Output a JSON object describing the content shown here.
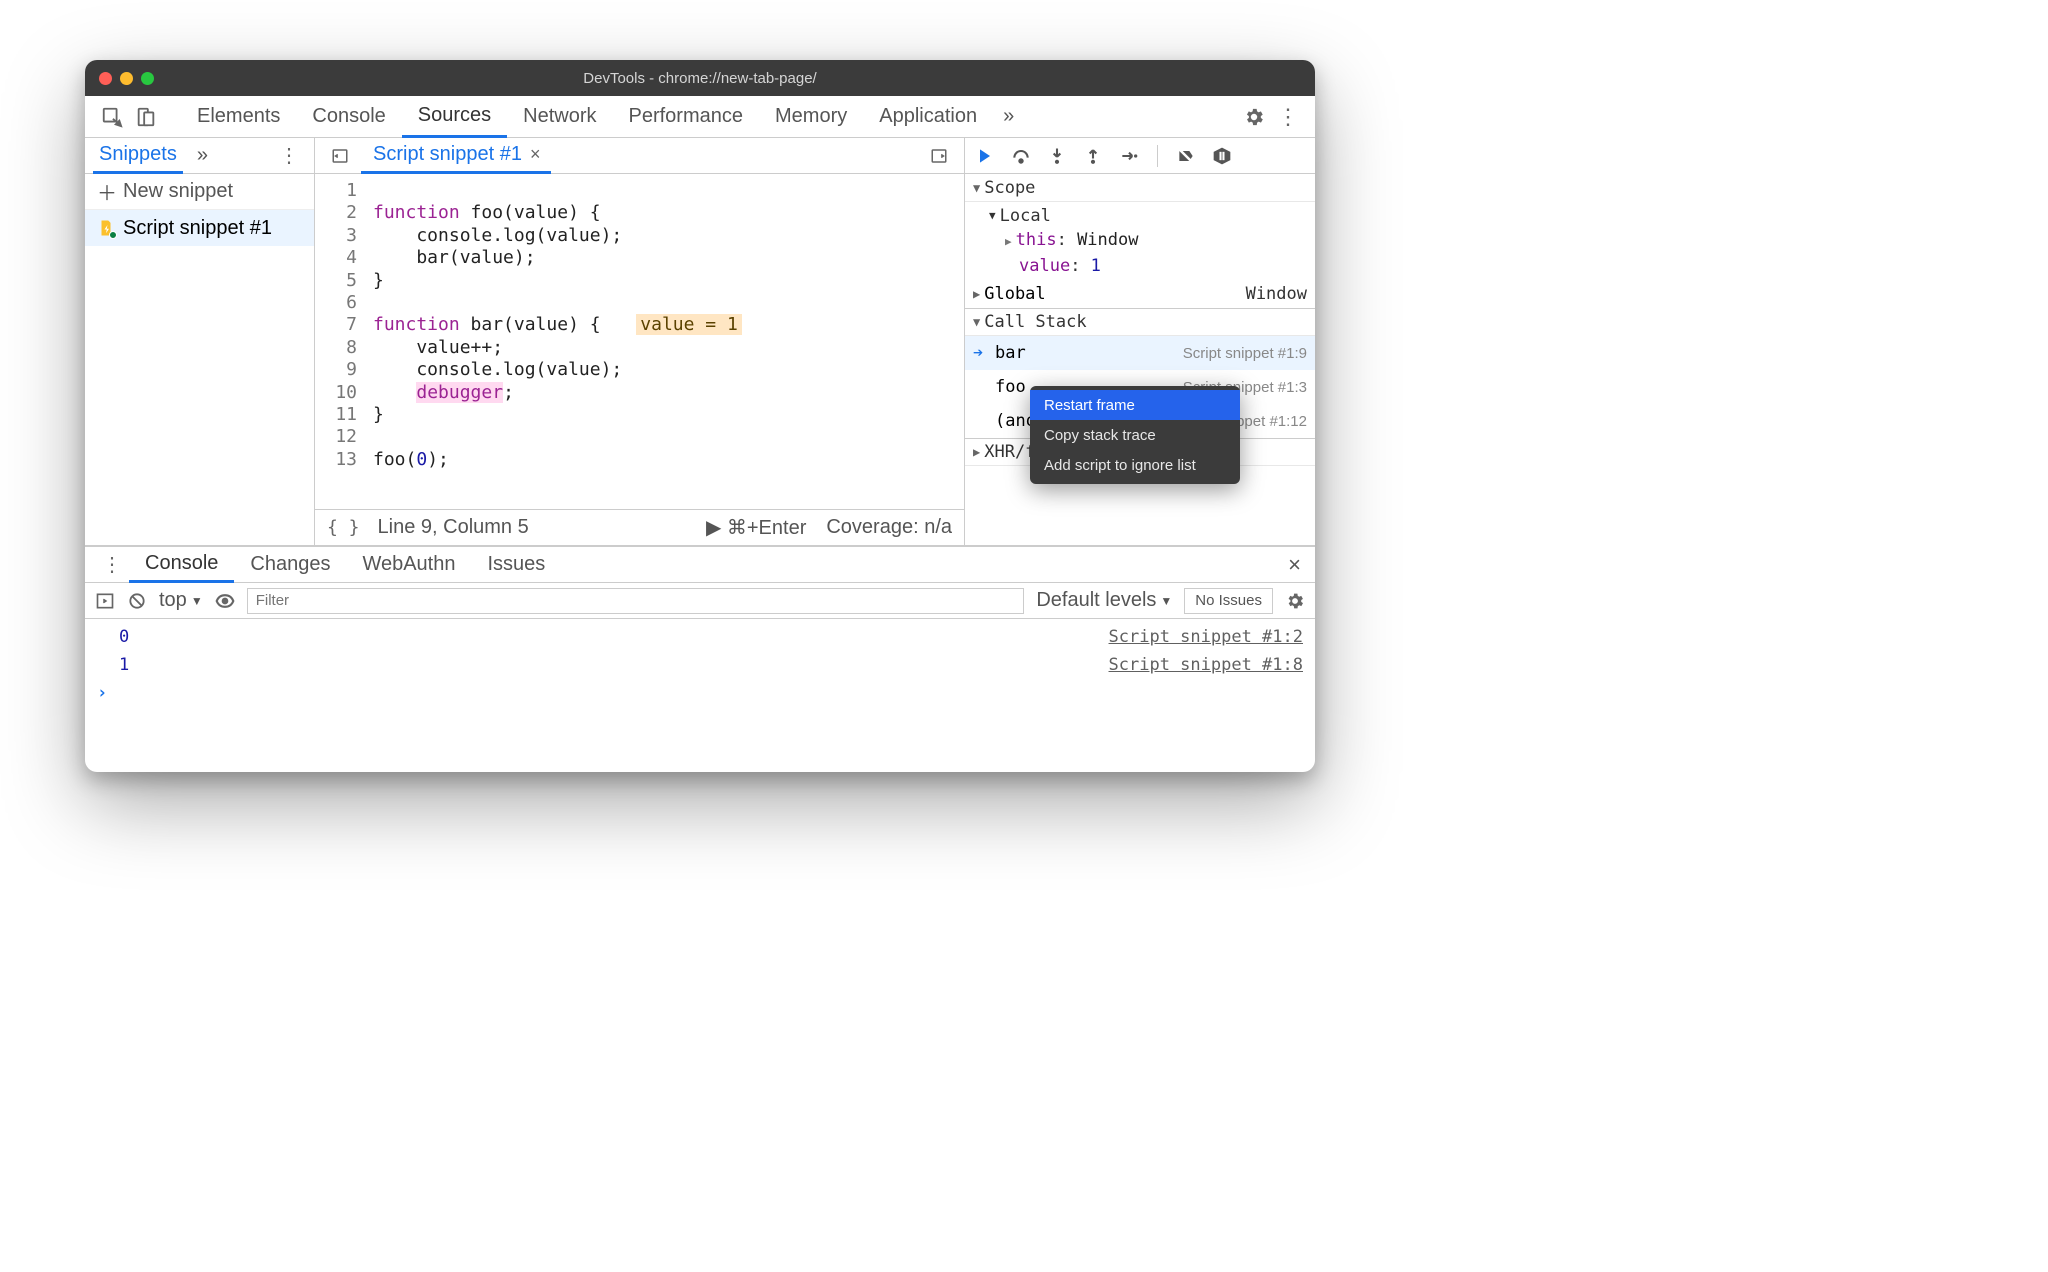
{
  "window": {
    "title": "DevTools - chrome://new-tab-page/"
  },
  "mainTabs": {
    "items": [
      "Elements",
      "Console",
      "Sources",
      "Network",
      "Performance",
      "Memory",
      "Application"
    ],
    "active": "Sources"
  },
  "sidebar": {
    "tab": "Snippets",
    "newLabel": "New snippet",
    "items": [
      {
        "label": "Script snippet #1"
      }
    ]
  },
  "editor": {
    "fileTab": "Script snippet #1",
    "lines": [
      "function foo(value) {",
      "    console.log(value);",
      "    bar(value);",
      "}",
      "",
      "function bar(value) {",
      "    value++;",
      "    console.log(value);",
      "    debugger;",
      "}",
      "",
      "foo(0);",
      ""
    ],
    "inlineHint": {
      "line": 6,
      "text": "value = 1"
    },
    "highlightedLine": 9,
    "status": {
      "cursor": "Line 9, Column 5",
      "run": "⌘+Enter",
      "coverage": "Coverage: n/a"
    }
  },
  "debugger": {
    "sections": {
      "scope": "Scope",
      "callstack": "Call Stack",
      "xhr": "XHR/fetch Breakpoints"
    },
    "local": {
      "label": "Local",
      "this": {
        "k": "this",
        "v": "Window"
      },
      "value": {
        "k": "value",
        "v": "1"
      }
    },
    "global": {
      "label": "Global",
      "value": "Window"
    },
    "stack": [
      {
        "name": "bar",
        "loc": "Script snippet #1:9",
        "selected": true
      },
      {
        "name": "foo",
        "loc": "Script snippet #1:3"
      },
      {
        "name": "(anonymous)",
        "loc": "Script snippet #1:12"
      }
    ]
  },
  "contextMenu": {
    "items": [
      "Restart frame",
      "Copy stack trace",
      "Add script to ignore list"
    ],
    "selected": 0
  },
  "drawer": {
    "tabs": [
      "Console",
      "Changes",
      "WebAuthn",
      "Issues"
    ],
    "active": "Console",
    "toolbar": {
      "context": "top",
      "filterPlaceholder": "Filter",
      "levels": "Default levels",
      "issues": "No Issues"
    },
    "lines": [
      {
        "value": "0",
        "source": "Script snippet #1:2"
      },
      {
        "value": "1",
        "source": "Script snippet #1:8"
      }
    ]
  }
}
